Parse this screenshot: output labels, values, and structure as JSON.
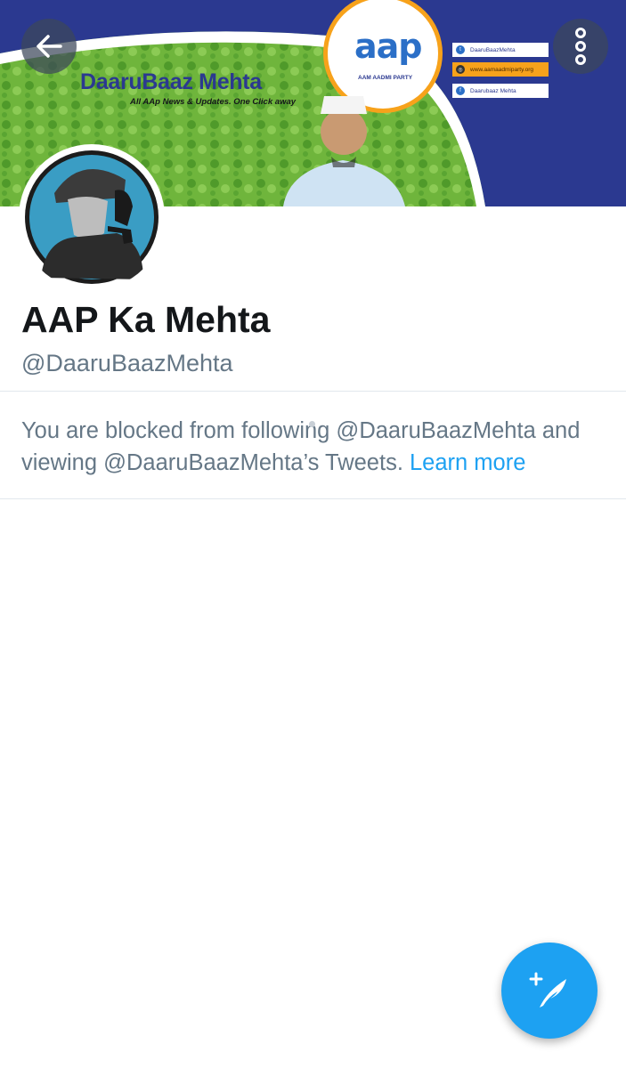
{
  "banner": {
    "title": "DaaruBaaz Mehta",
    "tagline": "All AAp News & Updates. One Click away",
    "logo_text": "aap",
    "logo_subtext": "AAM AADMI PARTY",
    "social": [
      {
        "icon": "twitter-icon",
        "label": "DaaruBaazMehta"
      },
      {
        "icon": "globe-icon",
        "label": "www.aamaadmiparty.org"
      },
      {
        "icon": "facebook-icon",
        "label": "Daarubaaz Mehta"
      }
    ]
  },
  "nav": {
    "back_icon": "back-arrow-icon",
    "more_icon": "more-options-icon"
  },
  "profile": {
    "display_name": "AAP Ka Mehta",
    "handle": "@DaaruBaazMehta"
  },
  "blocked_notice": {
    "text": "You are blocked from following @DaaruBaazMehta and viewing @DaaruBaazMehta’s Tweets.",
    "link_label": "Learn more"
  },
  "fab": {
    "icon": "compose-tweet-icon"
  },
  "colors": {
    "accent": "#1da1f2",
    "text_primary": "#14171a",
    "text_secondary": "#657786",
    "banner_blue": "#2b3990",
    "banner_green": "#6fb53c"
  }
}
